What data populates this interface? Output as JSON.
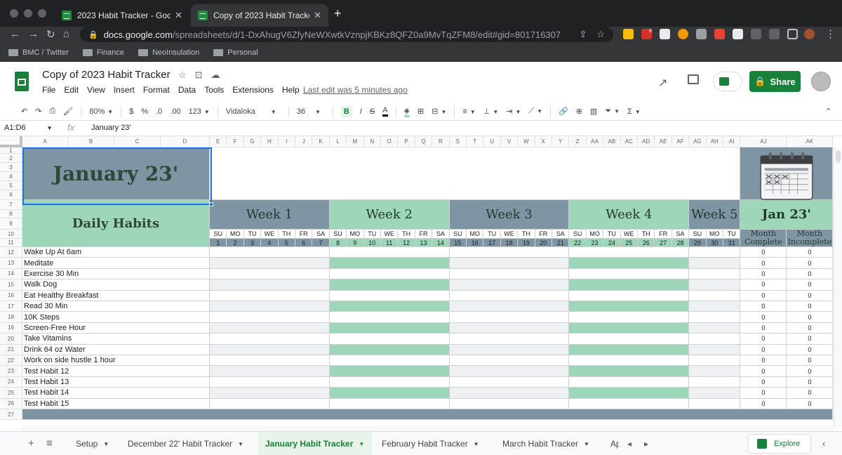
{
  "browser": {
    "tabs": [
      {
        "title": "2023 Habit Tracker - Google Sheets"
      },
      {
        "title": "Copy of 2023 Habit Tracker - Google Sheets"
      }
    ],
    "url_host": "docs.google.com",
    "url_path": "/spreadsheets/d/1-DxAhugV6ZfyNeWXwtkVznpjKBKz8QFZ0a9MvTqZFM8/edit#gid=801716307",
    "bookmarks": [
      "BMC / Twitter",
      "Finance",
      "NeoInsulation",
      "Personal"
    ],
    "extension_badge": "8"
  },
  "doc": {
    "title": "Copy of 2023 Habit Tracker",
    "menu": [
      "File",
      "Edit",
      "View",
      "Insert",
      "Format",
      "Data",
      "Tools",
      "Extensions",
      "Help"
    ],
    "last_edit": "Last edit was 5 minutes ago",
    "share_label": "Share"
  },
  "toolbar": {
    "zoom": "80%",
    "currency": "$",
    "percent": "%",
    "dec_less": ".0",
    "dec_more": ".00",
    "format": "123",
    "font": "Vidaloka",
    "font_size": "36",
    "bold": "B",
    "italic": "I",
    "strike": "S",
    "color": "A"
  },
  "formula": {
    "namebox": "A1:D6",
    "fx": "fx",
    "value": "January 23'"
  },
  "grid": {
    "columns": [
      "A",
      "B",
      "C",
      "D",
      "E",
      "F",
      "G",
      "H",
      "I",
      "J",
      "K",
      "L",
      "M",
      "N",
      "O",
      "P",
      "Q",
      "R",
      "S",
      "T",
      "U",
      "V",
      "W",
      "X",
      "Y",
      "Z",
      "AA",
      "AB",
      "AC",
      "AD",
      "AE",
      "AF",
      "AG",
      "AH",
      "AI",
      "AJ",
      "AK"
    ],
    "rows": [
      "1",
      "2",
      "3",
      "4",
      "5",
      "6",
      "7",
      "8",
      "9",
      "10",
      "11",
      "12",
      "13",
      "14",
      "15",
      "16",
      "17",
      "18",
      "19",
      "20",
      "21",
      "22",
      "23",
      "24",
      "25",
      "26",
      "27"
    ],
    "month_title": "January 23'",
    "daily_habits": "Daily Habits",
    "weeks": [
      "Week 1",
      "Week 2",
      "Week 3",
      "Week 4",
      "Week 5"
    ],
    "summary_title": "Jan 23'",
    "weekdays": [
      "SU",
      "MO",
      "TU",
      "WE",
      "TH",
      "FR",
      "SA",
      "SU",
      "MO",
      "TU",
      "WE",
      "TH",
      "FR",
      "SA",
      "SU",
      "MO",
      "TU",
      "WE",
      "TH",
      "FR",
      "SA",
      "SU",
      "MO",
      "TU",
      "WE",
      "TH",
      "FR",
      "SA",
      "SU",
      "MO",
      "TU"
    ],
    "dates": [
      "1",
      "2",
      "3",
      "4",
      "5",
      "6",
      "7",
      "8",
      "9",
      "10",
      "11",
      "12",
      "13",
      "14",
      "15",
      "16",
      "17",
      "18",
      "19",
      "20",
      "21",
      "22",
      "23",
      "24",
      "25",
      "26",
      "27",
      "28",
      "29",
      "30",
      "31"
    ],
    "month_complete": "Month Complete",
    "month_incomplete": "Month Incomplete",
    "habits": [
      {
        "name": "Wake Up At 6am",
        "complete": "0",
        "incomplete": "0"
      },
      {
        "name": "Meditate",
        "complete": "0",
        "incomplete": "0"
      },
      {
        "name": "Exercise 30 Min",
        "complete": "0",
        "incomplete": "0"
      },
      {
        "name": "Walk Dog",
        "complete": "0",
        "incomplete": "0"
      },
      {
        "name": "Eat Healthy Breakfast",
        "complete": "0",
        "incomplete": "0"
      },
      {
        "name": "Read 30 Min",
        "complete": "0",
        "incomplete": "0"
      },
      {
        "name": "10K Steps",
        "complete": "0",
        "incomplete": "0"
      },
      {
        "name": "Screen-Free Hour",
        "complete": "0",
        "incomplete": "0"
      },
      {
        "name": "Take Vitamins",
        "complete": "0",
        "incomplete": "0"
      },
      {
        "name": "Drink 64 oz Water",
        "complete": "0",
        "incomplete": "0"
      },
      {
        "name": "Work on side hustle 1 hour",
        "complete": "0",
        "incomplete": "0"
      },
      {
        "name": "Test Habit 12",
        "complete": "0",
        "incomplete": "0"
      },
      {
        "name": "Test Habit 13",
        "complete": "0",
        "incomplete": "0"
      },
      {
        "name": "Test Habit 14",
        "complete": "0",
        "incomplete": "0"
      },
      {
        "name": "Test Habit 15",
        "complete": "0",
        "incomplete": "0"
      }
    ]
  },
  "sheets": {
    "tabs": [
      "Setup",
      "December 22' Habit Tracker",
      "January Habit Tracker",
      "February Habit Tracker",
      "March Habit Tracker",
      "Ap"
    ],
    "active_index": 2,
    "explore_label": "Explore"
  },
  "colors": {
    "accent": "#188038",
    "header_blue": "#7f95a3",
    "header_green": "#9dd6b9"
  }
}
